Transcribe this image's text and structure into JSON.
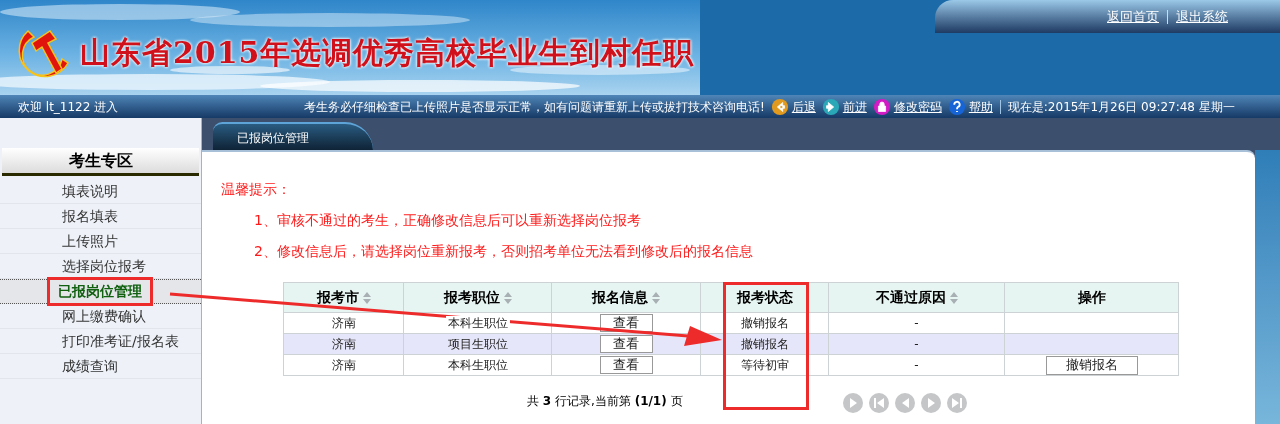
{
  "header": {
    "title": "山东省2015年选调优秀高校毕业生到村任职",
    "links": [
      "返回首页",
      "退出系统"
    ]
  },
  "toolbar": {
    "welcome": "欢迎  lt_1122 进入",
    "notice": "考生务必仔细检查已上传照片是否显示正常，如有问题请重新上传或拔打技术咨询电话!",
    "buttons": [
      {
        "kind": "back",
        "label": "后退"
      },
      {
        "kind": "forward",
        "label": "前进"
      },
      {
        "kind": "password",
        "label": "修改密码"
      },
      {
        "kind": "help",
        "label": "帮助"
      }
    ],
    "datetime": "现在是:2015年1月26日  09:27:48 星期一"
  },
  "sidebar": {
    "title": "考生专区",
    "items": [
      {
        "label": "填表说明",
        "selected": false,
        "annotated": false
      },
      {
        "label": "报名填表",
        "selected": false,
        "annotated": false
      },
      {
        "label": "上传照片",
        "selected": false,
        "annotated": false
      },
      {
        "label": "选择岗位报考",
        "selected": false,
        "annotated": false
      },
      {
        "label": "已报岗位管理",
        "selected": true,
        "annotated": true
      },
      {
        "label": "网上缴费确认",
        "selected": false,
        "annotated": false
      },
      {
        "label": "打印准考证/报名表",
        "selected": false,
        "annotated": false
      },
      {
        "label": "成绩查询",
        "selected": false,
        "annotated": false
      }
    ]
  },
  "tab": {
    "label": "已报岗位管理"
  },
  "tips": {
    "title": "温馨提示：",
    "lines": [
      "1、审核不通过的考生，正确修改信息后可以重新选择岗位报考",
      "2、修改信息后，请选择岗位重新报考，否则招考单位无法看到修改后的报名信息"
    ]
  },
  "table": {
    "columns": [
      {
        "label": "报考市",
        "sortable": true,
        "annotated": false
      },
      {
        "label": "报考职位",
        "sortable": true,
        "annotated": false
      },
      {
        "label": "报名信息",
        "sortable": true,
        "annotated": false
      },
      {
        "label": "报考状态",
        "sortable": false,
        "annotated": true
      },
      {
        "label": "不通过原因",
        "sortable": true,
        "annotated": false
      },
      {
        "label": "操作",
        "sortable": false,
        "annotated": false
      }
    ],
    "rows": [
      {
        "highlighted": false,
        "city": "济南",
        "position": "本科生职位",
        "info_button": "查看",
        "status": "撤销报名",
        "reason": "-"
      },
      {
        "highlighted": true,
        "city": "济南",
        "position": "项目生职位",
        "info_button": "查看",
        "status": "撤销报名",
        "reason": "-"
      },
      {
        "highlighted": false,
        "city": "济南",
        "position": "本科生职位",
        "info_button": "查看",
        "status": "等待初审",
        "reason": "-",
        "action_button": "撤销报名"
      }
    ]
  },
  "pager": {
    "summary": "共 **3** 行记录,当前第 **(1/1)** 页"
  }
}
